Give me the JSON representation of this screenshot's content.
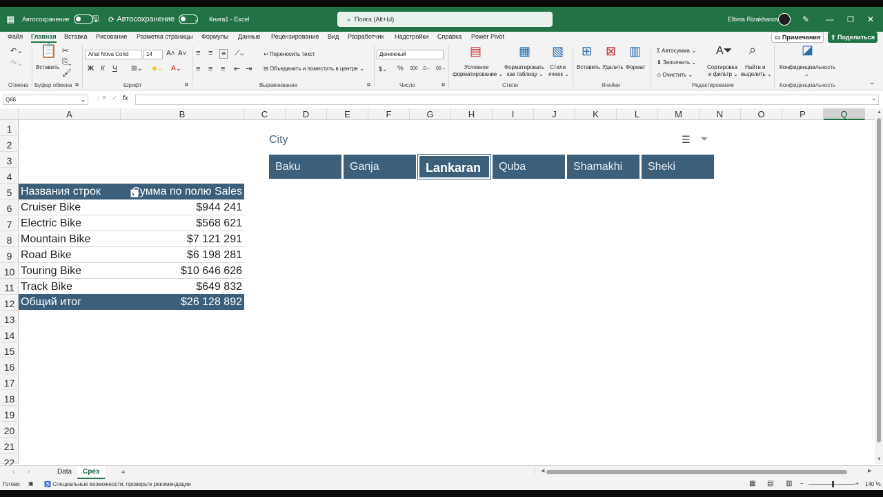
{
  "titlebar": {
    "autosave_label_1": "Автосохранение",
    "autosave_label_2": "Автосохранение",
    "doc_title": "Книга1  -  Excel",
    "search_placeholder": "Поиск (Alt+Ы)",
    "user_name": "Elbina Rizakhanova"
  },
  "menu": {
    "tabs": [
      "Файл",
      "Главная",
      "Вставка",
      "Рисование",
      "Разметка страницы",
      "Формулы",
      "Данные",
      "Рецензирование",
      "Вид",
      "Разработчик",
      "Надстройки",
      "Справка",
      "Power Pivot"
    ],
    "notes": "Примечания",
    "share": "Поделиться"
  },
  "ribbon": {
    "groups": [
      "Отмена",
      "Буфер обмена",
      "Шрифт",
      "Выравнивание",
      "Число",
      "Стили",
      "Ячейки",
      "Редактирование",
      "Конфиденциальность"
    ],
    "paste": "Вставить",
    "font_name": "Arial Nova Cond",
    "font_size": "14",
    "bold": "Ж",
    "italic": "К",
    "underline": "Ч",
    "wrap_text": "Переносить текст",
    "merge_center": "Объединить и поместить в центре",
    "number_format": "Денежный",
    "cond_format_1": "Условное",
    "cond_format_2": "форматирование",
    "format_table_1": "Форматировать",
    "format_table_2": "как таблицу",
    "cell_styles_1": "Стили",
    "cell_styles_2": "ячеек",
    "insert": "Вставить",
    "delete": "Удалить",
    "format": "Формат",
    "autosum": "Автосумма",
    "fill": "Заполнить",
    "clear": "Очистить",
    "sort_1": "Сортировка",
    "sort_2": "и фильтр",
    "find_1": "Найти и",
    "find_2": "выделить",
    "privacy": "Конфиденциальность"
  },
  "formula_bar": {
    "name_box": "Q66",
    "fx": "fx",
    "content": ""
  },
  "columns": [
    "A",
    "B",
    "C",
    "D",
    "E",
    "F",
    "G",
    "H",
    "I",
    "J",
    "K",
    "L",
    "M",
    "N",
    "O",
    "P",
    "Q"
  ],
  "selected_column": "Q",
  "rows": [
    "1",
    "2",
    "3",
    "4",
    "5",
    "6",
    "7",
    "8",
    "9",
    "10",
    "11",
    "12",
    "13",
    "14",
    "15",
    "16",
    "17",
    "18",
    "19",
    "20",
    "21",
    "22"
  ],
  "pivot": {
    "header_a": "Названия строк",
    "header_b": "Сумма по полю Sales",
    "rows": [
      {
        "label": "Cruiser Bike",
        "value": "$944 241"
      },
      {
        "label": "Electric Bike",
        "value": "$568 621"
      },
      {
        "label": "Mountain Bike",
        "value": "$7 121 291"
      },
      {
        "label": "Road Bike",
        "value": "$6 198 281"
      },
      {
        "label": "Touring Bike",
        "value": "$10 646 626"
      },
      {
        "label": "Track Bike",
        "value": "$649 832"
      }
    ],
    "total_label": "Общий итог",
    "total_value": "$26 128 892"
  },
  "slicer": {
    "title": "City",
    "items": [
      "Baku",
      "Ganja",
      "Lankaran",
      "Quba",
      "Shamakhi",
      "Sheki"
    ],
    "selected": "Lankaran"
  },
  "sheets": [
    "Data",
    "Срез"
  ],
  "active_sheet": "Срез",
  "status": {
    "ready": "Готово",
    "accessibility": "Специальные возможности: проверьте рекомендации",
    "zoom": "140 %"
  },
  "colors": {
    "brand": "#217346",
    "pivot": "#3d5f7a"
  }
}
